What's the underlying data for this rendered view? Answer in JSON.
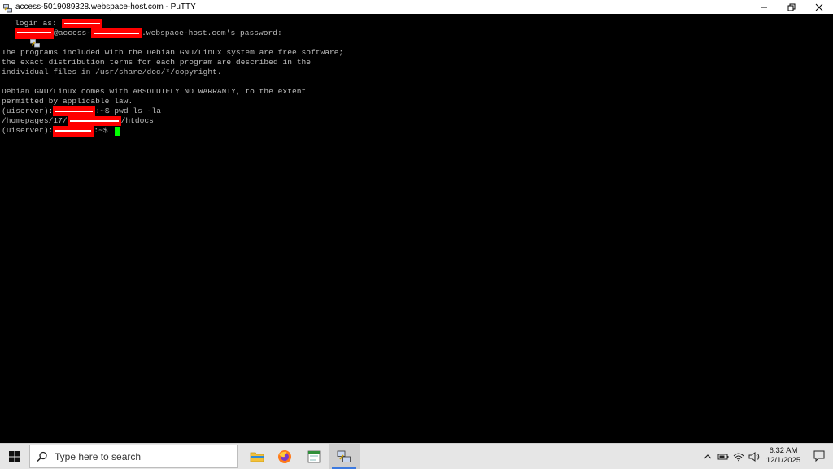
{
  "window": {
    "title": "access-5019089328.webspace-host.com - PuTTY",
    "controls": [
      "minimize",
      "restore",
      "close"
    ]
  },
  "terminal": {
    "login_label": "login as: ",
    "password_mid": "@access-",
    "password_end": ".webspace-host.com's password:",
    "info1": "The programs included with the Debian GNU/Linux system are free software;",
    "info2": "the exact distribution terms for each program are described in the",
    "info3": "individual files in /usr/share/doc/*/copyright.",
    "info4": "Debian GNU/Linux comes with ABSOLUTELY NO WARRANTY, to the extent",
    "info5": "permitted by applicable law.",
    "prompt_prefix": "(uiserver):",
    "prompt_suffix": ":~$ ",
    "command": "pwd ls -la",
    "path_start": "/homepages/17/",
    "path_end": "/htdocs",
    "cursor_color": "#00ff00",
    "redact_color": "#ff0000"
  },
  "taskbar": {
    "search_placeholder": "Type here to search",
    "apps": [
      "file-explorer-icon",
      "firefox-icon",
      "notepad-icon",
      "putty-icon"
    ],
    "clock_time": "6:32 AM",
    "clock_date": "12/1/2025"
  }
}
